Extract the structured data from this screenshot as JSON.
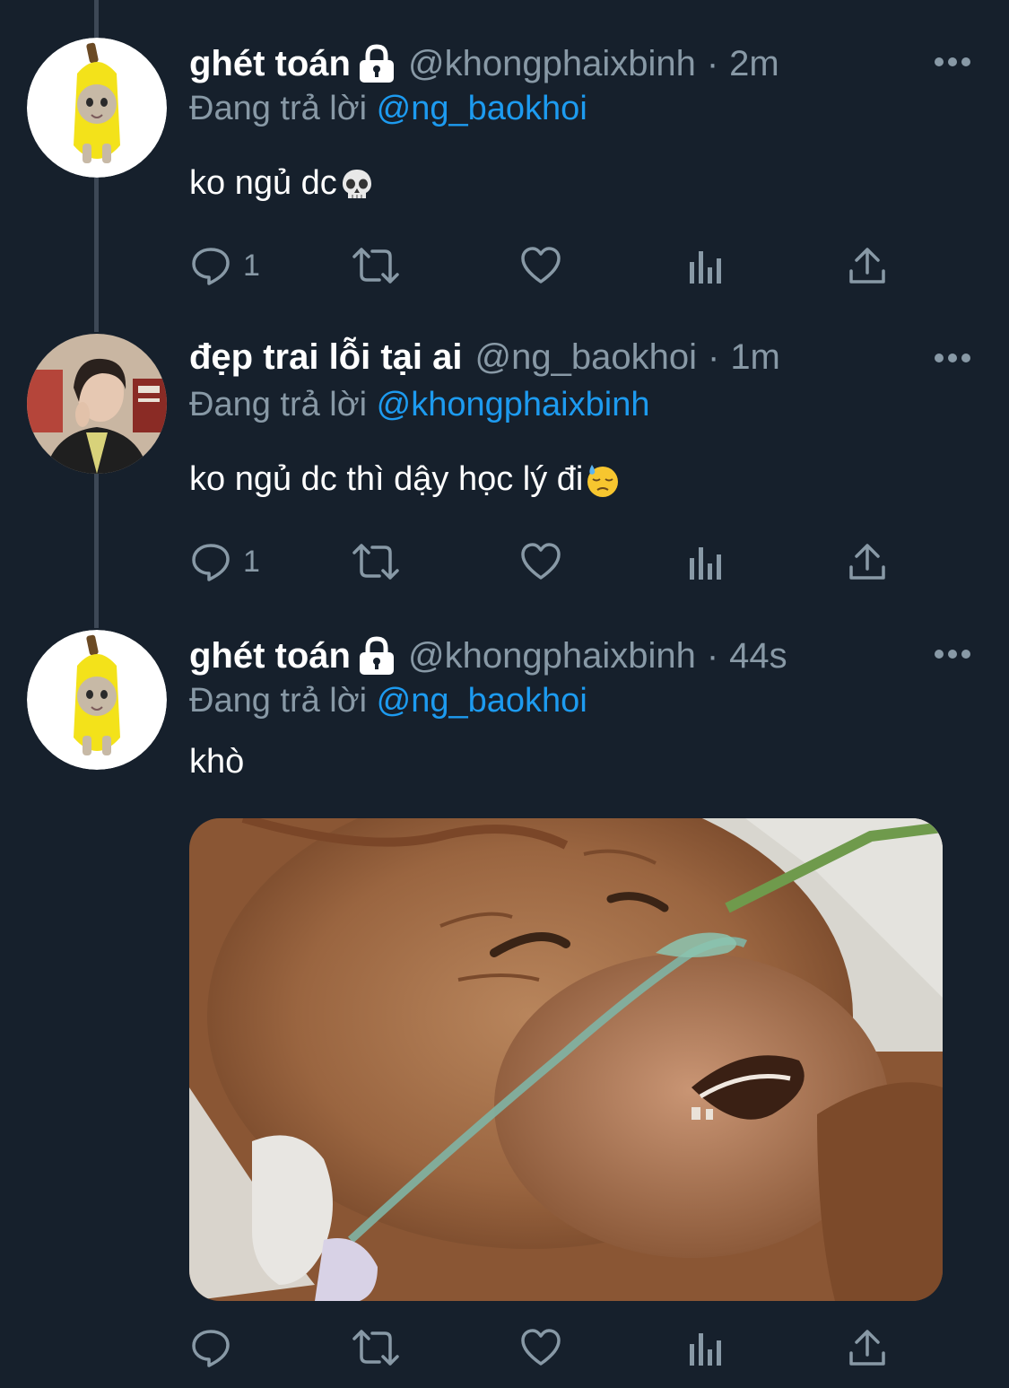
{
  "colors": {
    "background": "#16202c",
    "primary_text": "#ffffff",
    "secondary_text": "#8899a6",
    "link": "#1d9bf0",
    "thread_line": "#3d4856"
  },
  "tweets": [
    {
      "display_name": "ghét toán",
      "locked": true,
      "handle": "@khongphaixbinh",
      "separator": "·",
      "time": "2m",
      "reply_prefix": "Đang trả lời",
      "reply_to": "@ng_baokhoi",
      "text": "ko ngủ dc",
      "emoji": "skull-icon",
      "reply_count": "1",
      "avatar": "banana-cat-avatar"
    },
    {
      "display_name": "đẹp trai lỗi tại ai",
      "locked": false,
      "handle": "@ng_baokhoi",
      "separator": "·",
      "time": "1m",
      "reply_prefix": "Đang trả lời",
      "reply_to": "@khongphaixbinh",
      "text": "ko ngủ dc thì dậy học lý đi",
      "emoji": "downcast-sweat-face-icon",
      "reply_count": "1",
      "avatar": "young-man-photo-avatar"
    },
    {
      "display_name": "ghét toán",
      "locked": true,
      "handle": "@khongphaixbinh",
      "separator": "·",
      "time": "44s",
      "reply_prefix": "Đang trả lời",
      "reply_to": "@ng_baokhoi",
      "text": "khò",
      "emoji": "",
      "reply_count": "",
      "avatar": "banana-cat-avatar",
      "media": "sleeping-orangutan-photo"
    }
  ],
  "action_icons": [
    "reply-icon",
    "retweet-icon",
    "like-icon",
    "analytics-icon",
    "share-icon"
  ]
}
